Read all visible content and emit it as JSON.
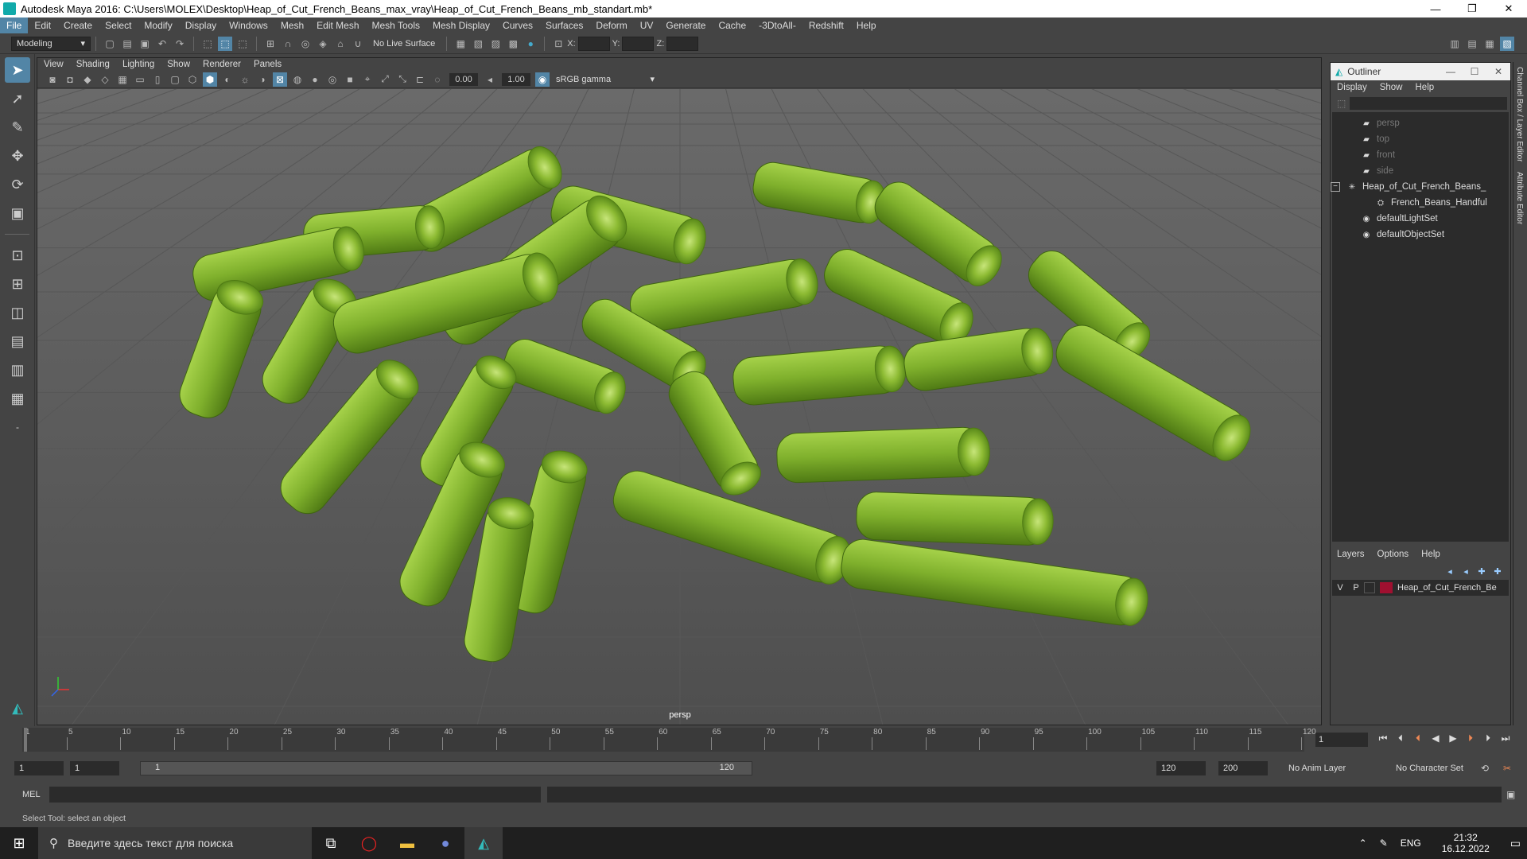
{
  "window": {
    "title": "Autodesk Maya 2016: C:\\Users\\MOLEX\\Desktop\\Heap_of_Cut_French_Beans_max_vray\\Heap_of_Cut_French_Beans_mb_standart.mb*"
  },
  "menubar": [
    "File",
    "Edit",
    "Create",
    "Select",
    "Modify",
    "Display",
    "Windows",
    "Mesh",
    "Edit Mesh",
    "Mesh Tools",
    "Mesh Display",
    "Curves",
    "Surfaces",
    "Deform",
    "UV",
    "Generate",
    "Cache",
    "-3DtoAll-",
    "Redshift",
    "Help"
  ],
  "statusline": {
    "mode": "Modeling",
    "live_surface": "No Live Surface",
    "x_label": "X:",
    "y_label": "Y:",
    "z_label": "Z:"
  },
  "viewport": {
    "menu": [
      "View",
      "Shading",
      "Lighting",
      "Show",
      "Renderer",
      "Panels"
    ],
    "exposure": "0.00",
    "gamma": "1.00",
    "colorspace": "sRGB gamma",
    "camera": "persp"
  },
  "outliner": {
    "title": "Outliner",
    "menu": [
      "Display",
      "Show",
      "Help"
    ],
    "nodes": [
      {
        "label": "persp",
        "icon": "camera-icon",
        "dim": true,
        "indent": 2
      },
      {
        "label": "top",
        "icon": "camera-icon",
        "dim": true,
        "indent": 2
      },
      {
        "label": "front",
        "icon": "camera-icon",
        "dim": true,
        "indent": 2
      },
      {
        "label": "side",
        "icon": "camera-icon",
        "dim": true,
        "indent": 2
      },
      {
        "label": "Heap_of_Cut_French_Beans_",
        "icon": "group-icon",
        "dim": false,
        "indent": 1,
        "expander": "−"
      },
      {
        "label": "French_Beans_Handful",
        "icon": "mesh-icon",
        "dim": false,
        "indent": 3
      },
      {
        "label": "defaultLightSet",
        "icon": "set-icon",
        "dim": false,
        "indent": 2
      },
      {
        "label": "defaultObjectSet",
        "icon": "set-icon",
        "dim": false,
        "indent": 2
      }
    ]
  },
  "layers": {
    "tabs": [
      "Layers",
      "Options",
      "Help"
    ],
    "row": {
      "v": "V",
      "p": "P",
      "name": "Heap_of_Cut_French_Be"
    }
  },
  "sidetabs": [
    "Channel Box / Layer Editor",
    "Attribute Editor"
  ],
  "timeline": {
    "ticks": [
      "5",
      "10",
      "15",
      "20",
      "25",
      "30",
      "35",
      "40",
      "45",
      "50",
      "55",
      "60",
      "65",
      "70",
      "75",
      "80",
      "85",
      "90",
      "95",
      "100",
      "105",
      "110",
      "115",
      "120"
    ],
    "first_tick": "1",
    "current_frame": "1"
  },
  "range": {
    "start": "1",
    "playback_start": "1",
    "slider_start": "1",
    "slider_end": "120",
    "playback_end": "120",
    "end": "200",
    "anim_layer": "No Anim Layer",
    "character_set": "No Character Set"
  },
  "cmdline": {
    "label": "MEL"
  },
  "helpline": "Select Tool: select an object",
  "taskbar": {
    "search_placeholder": "Введите здесь текст для поиска",
    "lang": "ENG",
    "time": "21:32",
    "date": "16.12.2022"
  }
}
